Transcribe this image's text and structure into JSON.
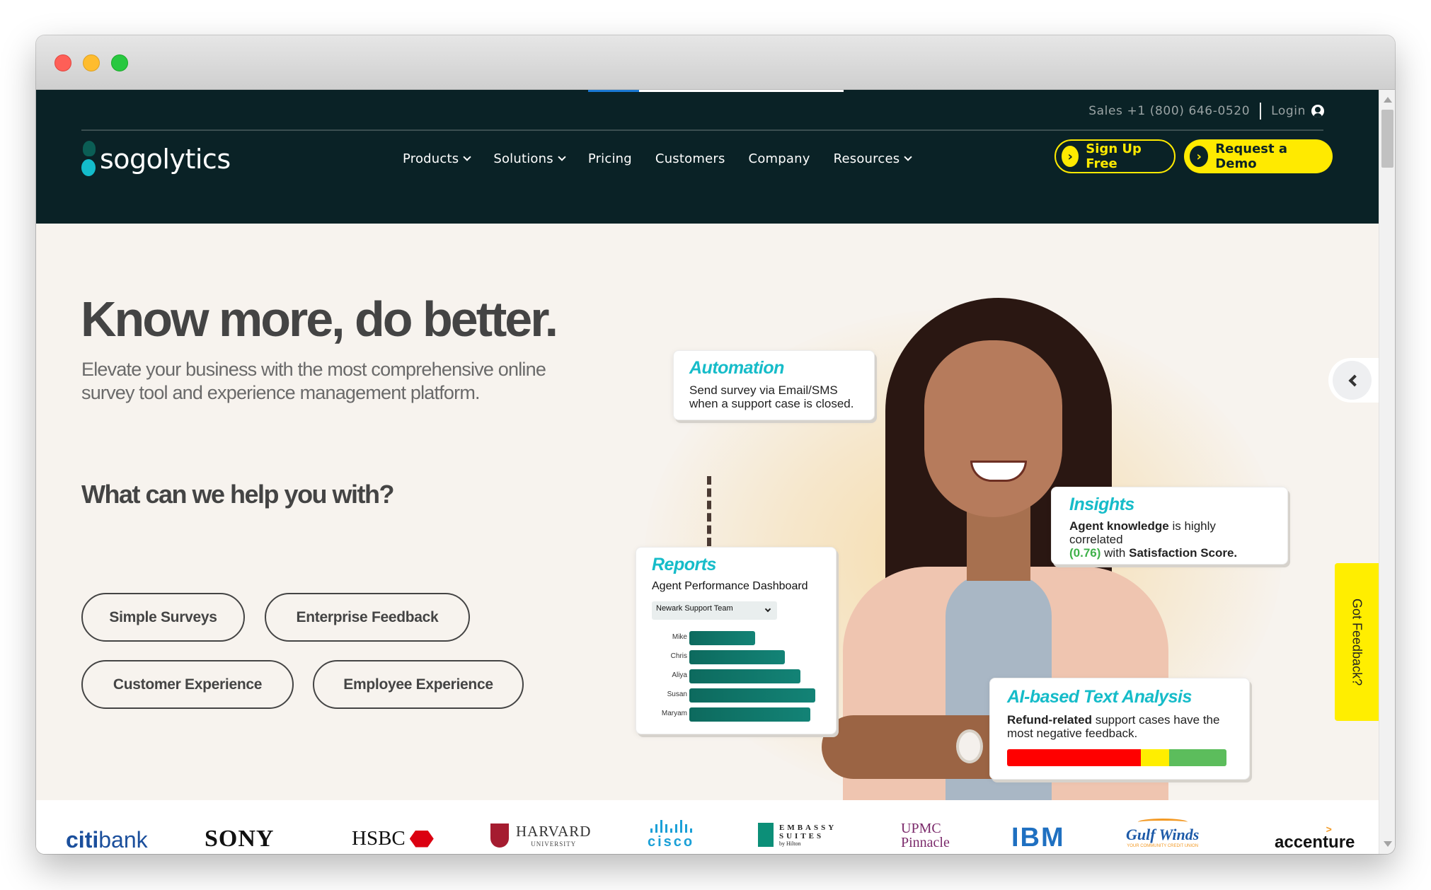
{
  "browser": {
    "page_load_progress": 0.2
  },
  "header": {
    "logo_text": "sogolytics",
    "sales_phone": "Sales +1 (800) 646-0520",
    "login_label": "Login",
    "menu": [
      {
        "label": "Products",
        "has_dropdown": true
      },
      {
        "label": "Solutions",
        "has_dropdown": true
      },
      {
        "label": "Pricing",
        "has_dropdown": false
      },
      {
        "label": "Customers",
        "has_dropdown": false
      },
      {
        "label": "Company",
        "has_dropdown": false
      },
      {
        "label": "Resources",
        "has_dropdown": true
      }
    ],
    "signup_label": "Sign Up Free",
    "demo_label": "Request a Demo",
    "cta_arrow_glyph": "›",
    "colors": {
      "nav_bg": "#0a2226",
      "accent_yellow": "#ffea00"
    }
  },
  "hero": {
    "headline": "Know more, do better.",
    "subhead": "Elevate your business with the most comprehensive online survey tool and experience management platform.",
    "help_question": "What can we help you with?",
    "options": [
      "Simple Surveys",
      "Enterprise Feedback",
      "Customer Experience",
      "Employee Experience"
    ]
  },
  "cards": {
    "automation": {
      "title": "Automation",
      "line1": "Send survey via Email/SMS",
      "line2": "when a support case is closed."
    },
    "reports": {
      "title": "Reports",
      "subtitle": "Agent Performance Dashboard",
      "dropdown_value": "Newark Support Team"
    },
    "insights": {
      "title": "Insights",
      "bold1": "Agent knowledge",
      "text1": " is highly correlated",
      "value": "(0.76)",
      "text2": " with ",
      "bold2": "Satisfaction Score."
    },
    "ai": {
      "title": "AI-based Text Analysis",
      "bold": "Refund-related",
      "text": " support cases have the most negative feedback.",
      "sentiment": {
        "negative": 0.61,
        "neutral": 0.13,
        "positive": 0.26
      }
    }
  },
  "chart_data": {
    "type": "bar",
    "title": "Agent Performance Dashboard",
    "categories": [
      "Mike",
      "Chris",
      "Aliya",
      "Susan",
      "Maryam"
    ],
    "values": [
      52,
      76,
      88,
      100,
      96
    ],
    "xlabel": "",
    "ylabel": "",
    "ylim": [
      0,
      100
    ],
    "orientation": "horizontal"
  },
  "side": {
    "feedback_label": "Got Feedback?"
  },
  "logos": [
    "citibank",
    "SONY",
    "HSBC",
    "HARVARD",
    "cisco",
    "EMBASSY SUITES",
    "UPMC Pinnacle",
    "IBM",
    "Gulf Winds",
    "accenture"
  ],
  "logo_sub": {
    "harvard": "UNIVERSITY",
    "embassy1": "EMBASSY",
    "embassy2": "SUITES",
    "embassy3": "by Hilton",
    "upmc1": "UPMC",
    "upmc2": "Pinnacle",
    "gulf_tag": "YOUR COMMUNITY CREDIT UNION"
  }
}
